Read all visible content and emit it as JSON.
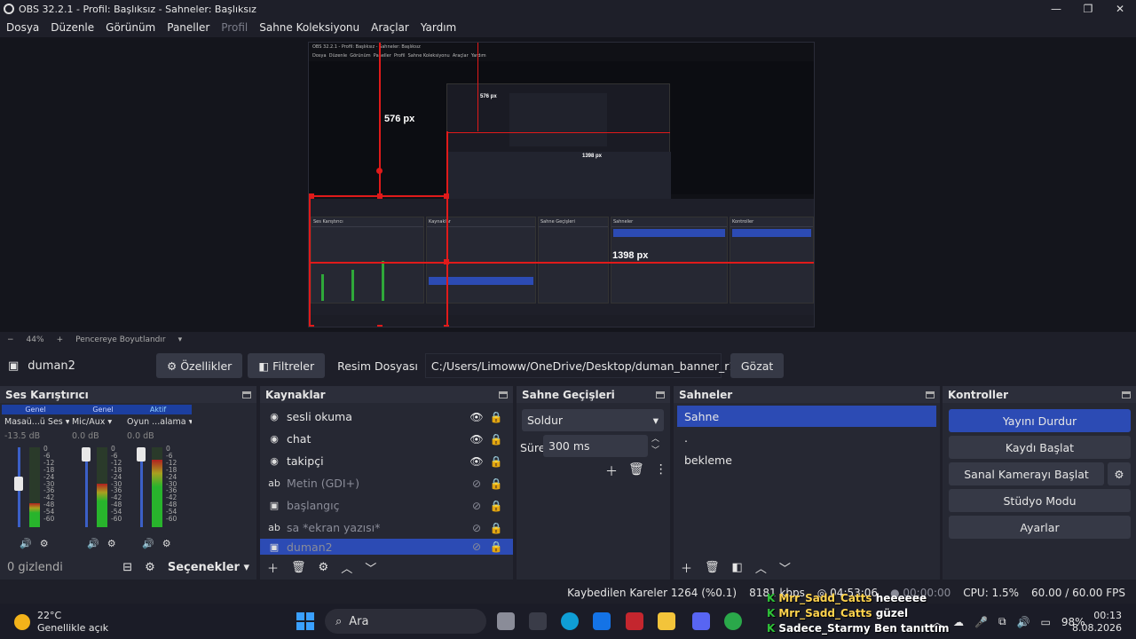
{
  "window": {
    "title": "OBS 32.2.1 - Profil: Başlıksız - Sahneler: Başlıksız",
    "controls": [
      "—",
      "❐",
      "✕"
    ]
  },
  "menu": [
    {
      "label": "Dosya",
      "disabled": false
    },
    {
      "label": "Düzenle",
      "disabled": false
    },
    {
      "label": "Görünüm",
      "disabled": false
    },
    {
      "label": "Paneller",
      "disabled": false
    },
    {
      "label": "Profil",
      "disabled": true
    },
    {
      "label": "Sahne Koleksiyonu",
      "disabled": false
    },
    {
      "label": "Araçlar",
      "disabled": false
    },
    {
      "label": "Yardım",
      "disabled": false
    }
  ],
  "preview": {
    "measure_height": "576 px",
    "measure_width": "1398 px",
    "nested_measure": "576 px",
    "nested_measure_width": "1398 px"
  },
  "zoombar": {
    "minus": "−",
    "zoom": "44%",
    "plus": "+",
    "fit_label": "Pencereye Boyutlandır"
  },
  "source_toolbar": {
    "source_name": "duman2",
    "properties_label": "Özellikler",
    "filters_label": "Filtreler",
    "path_label": "Resim Dosyası",
    "path_value": "C:/Users/Limoww/OneDrive/Desktop/duman_banner_r1_c8.jpg",
    "browse_label": "Gözat"
  },
  "mixer": {
    "title": "Ses Karıştırıcı",
    "channels": [
      {
        "tag": "Genel",
        "name": "Masaü...ü Ses",
        "db": "-13.5 dB",
        "level": 0.3,
        "fader": 0.55
      },
      {
        "tag": "Genel",
        "name": "Mic/Aux",
        "db": "0.0 dB",
        "level": 0.55,
        "fader": 1.0
      },
      {
        "tag": "Aktif",
        "name": "Oyun ...alama",
        "db": "0.0 dB",
        "level": 0.85,
        "fader": 1.0
      }
    ],
    "scale": [
      "0",
      "-6",
      "-12",
      "-18",
      "-24",
      "-30",
      "-36",
      "-42",
      "-48",
      "-54",
      "-60"
    ],
    "hidden_count": "0 gizlendi",
    "options_label": "Seçenekler"
  },
  "sources": {
    "title": "Kaynaklar",
    "items": [
      {
        "label": "sesli okuma",
        "icon": "globe-icon",
        "glyph": "◉",
        "visible": true
      },
      {
        "label": "chat",
        "icon": "globe-icon",
        "glyph": "◉",
        "visible": true
      },
      {
        "label": "takipçi",
        "icon": "globe-icon",
        "glyph": "◉",
        "visible": true
      },
      {
        "label": "Metin (GDI+)",
        "icon": "text-icon",
        "glyph": "ab",
        "visible": false
      },
      {
        "label": "başlangıç",
        "icon": "image-icon",
        "glyph": "▣",
        "visible": false
      },
      {
        "label": "sa *ekran yazısı*",
        "icon": "text-icon",
        "glyph": "ab",
        "visible": false
      },
      {
        "label": "duman2",
        "icon": "image-icon",
        "glyph": "▣",
        "visible": false,
        "selected": true
      }
    ]
  },
  "transitions": {
    "title": "Sahne Geçişleri",
    "selected": "Soldur",
    "duration_label": "Süre",
    "duration_value": "300 ms"
  },
  "scenes": {
    "title": "Sahneler",
    "items": [
      {
        "label": "Sahne",
        "selected": true
      },
      {
        "label": ".",
        "selected": false
      },
      {
        "label": "bekleme",
        "selected": false
      }
    ]
  },
  "controls": {
    "title": "Kontroller",
    "stop_stream": "Yayını Durdur",
    "start_record": "Kaydı Başlat",
    "virtual_cam": "Sanal Kamerayı Başlat",
    "studio_mode": "Stüdyo Modu",
    "settings": "Ayarlar"
  },
  "status": {
    "dropped": "Kaybedilen Kareler 1264 (%0.1)",
    "bitrate": "8181 kbps",
    "stream_time": "04:53:06",
    "record_time": "00:00:00",
    "cpu": "CPU: 1.5%",
    "fps": "60.00 / 60.00 FPS"
  },
  "taskbar": {
    "temperature": "22°C",
    "weather": "Genellikle açık",
    "search": "Ara",
    "battery": "98%",
    "time": "00:13",
    "date": "8.08.2026"
  },
  "chat_overlay": [
    {
      "user": "Mrr_Sadd_Catts",
      "msg": "heeeeee"
    },
    {
      "user": "Mrr_Sadd_Catts",
      "msg": "güzel"
    },
    {
      "user": "Sadece_Starmy",
      "msg": "Ben tanıttım"
    }
  ],
  "colors": {
    "accent": "#2c4bb4",
    "bg": "#1e1f29",
    "panel": "#262833",
    "measure": "#e01a1a"
  }
}
